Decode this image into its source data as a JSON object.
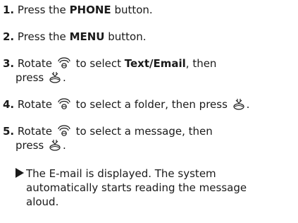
{
  "steps": [
    {
      "num": "1.",
      "t1": "Press the ",
      "kw": "PHONE",
      "t2": " button."
    },
    {
      "num": "2.",
      "t1": "Press the ",
      "kw": "MENU",
      "t2": " button."
    },
    {
      "num": "3.",
      "t1": "Rotate ",
      "t2": " to select ",
      "kw": "Text/Email",
      "t3": ", then",
      "t4": "press ",
      "t5": "."
    },
    {
      "num": "4.",
      "t1": "Rotate ",
      "t2": " to select a folder, then press ",
      "t3": "."
    },
    {
      "num": "5.",
      "t1": "Rotate ",
      "t2": " to select a message, then",
      "t3": "press ",
      "t4": "."
    }
  ],
  "result": {
    "line1": "The E-mail is displayed. The system",
    "line2": "automatically starts reading the message",
    "line3": "aloud."
  },
  "icons": {
    "rotate": "rotate-knob-icon",
    "press": "press-knob-icon"
  },
  "colors": {
    "text": "#1a1a1a"
  }
}
